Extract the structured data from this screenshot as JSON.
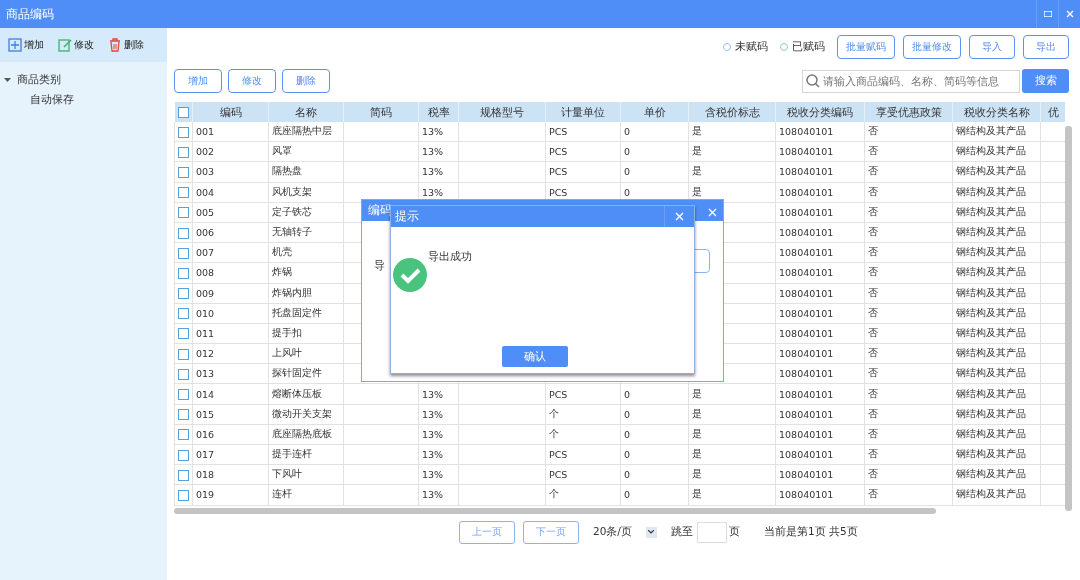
{
  "window": {
    "title": "商品编码"
  },
  "sidebar": {
    "actions": [
      "增加",
      "修改",
      "删除"
    ],
    "tree": [
      {
        "label": "商品类别",
        "expanded": true,
        "children": [
          {
            "label": "自动保存"
          }
        ]
      }
    ]
  },
  "filters": [
    {
      "label": "未赋码",
      "selected": false
    },
    {
      "label": "已赋码",
      "selected": false
    }
  ],
  "top_buttons": [
    "批量赋码",
    "批量修改",
    "导入",
    "导出"
  ],
  "table_buttons": [
    "增加",
    "修改",
    "删除"
  ],
  "search": {
    "placeholder": "请输入商品编码、名称、简码等信息",
    "button": "搜索"
  },
  "table": {
    "header_checked": false,
    "columns": [
      "编码",
      "名称",
      "简码",
      "税率",
      "规格型号",
      "计量单位",
      "单价",
      "含税价标志",
      "税收分类编码",
      "享受优惠政策",
      "税收分类名称",
      "优"
    ],
    "rows": [
      {
        "checked": false,
        "cells": [
          "001",
          "底座隔热中层",
          null,
          "13%",
          null,
          "PCS",
          "0",
          "是",
          "108040101",
          "否",
          "钢结构及其产品"
        ]
      },
      {
        "checked": false,
        "cells": [
          "002",
          "风罩",
          null,
          "13%",
          null,
          "PCS",
          "0",
          "是",
          "108040101",
          "否",
          "钢结构及其产品"
        ]
      },
      {
        "checked": false,
        "cells": [
          "003",
          "隔热盘",
          null,
          "13%",
          null,
          "PCS",
          "0",
          "是",
          "108040101",
          "否",
          "钢结构及其产品"
        ]
      },
      {
        "checked": false,
        "cells": [
          "004",
          "风机支架",
          null,
          "13%",
          null,
          "PCS",
          "0",
          "是",
          "108040101",
          "否",
          "钢结构及其产品"
        ]
      },
      {
        "checked": false,
        "cells": [
          "005",
          "定子铁芯",
          null,
          null,
          null,
          null,
          null,
          null,
          "108040101",
          "否",
          "钢结构及其产品"
        ]
      },
      {
        "checked": false,
        "cells": [
          "006",
          "无轴转子",
          null,
          null,
          null,
          null,
          null,
          null,
          "108040101",
          "否",
          "钢结构及其产品"
        ]
      },
      {
        "checked": false,
        "cells": [
          "007",
          "机壳",
          null,
          null,
          null,
          null,
          null,
          null,
          "108040101",
          "否",
          "钢结构及其产品"
        ]
      },
      {
        "checked": false,
        "cells": [
          "008",
          "炸锅",
          null,
          null,
          null,
          null,
          null,
          null,
          "108040101",
          "否",
          "钢结构及其产品"
        ]
      },
      {
        "checked": false,
        "cells": [
          "009",
          "炸锅内胆",
          null,
          null,
          null,
          null,
          null,
          null,
          "108040101",
          "否",
          "钢结构及其产品"
        ]
      },
      {
        "checked": false,
        "cells": [
          "010",
          "托盘固定件",
          null,
          null,
          null,
          null,
          null,
          null,
          "108040101",
          "否",
          "钢结构及其产品"
        ]
      },
      {
        "checked": false,
        "cells": [
          "011",
          "提手扣",
          null,
          null,
          null,
          null,
          null,
          null,
          "108040101",
          "否",
          "钢结构及其产品"
        ]
      },
      {
        "checked": false,
        "cells": [
          "012",
          "上风叶",
          null,
          null,
          null,
          null,
          null,
          null,
          "108040101",
          "否",
          "钢结构及其产品"
        ]
      },
      {
        "checked": false,
        "cells": [
          "013",
          "探针固定件",
          null,
          null,
          null,
          null,
          null,
          null,
          "108040101",
          "否",
          "钢结构及其产品"
        ]
      },
      {
        "checked": false,
        "cells": [
          "014",
          "熔断体压板",
          null,
          "13%",
          null,
          "PCS",
          "0",
          "是",
          "108040101",
          "否",
          "钢结构及其产品"
        ]
      },
      {
        "checked": false,
        "cells": [
          "015",
          "微动开关支架",
          null,
          "13%",
          null,
          "个",
          "0",
          "是",
          "108040101",
          "否",
          "钢结构及其产品"
        ]
      },
      {
        "checked": false,
        "cells": [
          "016",
          "底座隔热底板",
          null,
          "13%",
          null,
          "个",
          "0",
          "是",
          "108040101",
          "否",
          "钢结构及其产品"
        ]
      },
      {
        "checked": false,
        "cells": [
          "017",
          "提手连杆",
          null,
          "13%",
          null,
          "PCS",
          "0",
          "是",
          "108040101",
          "否",
          "钢结构及其产品"
        ]
      },
      {
        "checked": false,
        "cells": [
          "018",
          "下风叶",
          null,
          "13%",
          null,
          "PCS",
          "0",
          "是",
          "108040101",
          "否",
          "钢结构及其产品"
        ]
      },
      {
        "checked": false,
        "cells": [
          "019",
          "连杆",
          null,
          "13%",
          null,
          "个",
          "0",
          "是",
          "108040101",
          "否",
          "钢结构及其产品"
        ]
      }
    ]
  },
  "pager": {
    "prev": "上一页",
    "next": "下一页",
    "page_size": "20条/页",
    "jump_label": "跳至",
    "jump_unit": "页",
    "status": "当前是第1页 共5页"
  },
  "back_dialog": {
    "title": "编码",
    "label": "导"
  },
  "message_dialog": {
    "title": "提示",
    "message": "导出成功",
    "button": "确认"
  }
}
